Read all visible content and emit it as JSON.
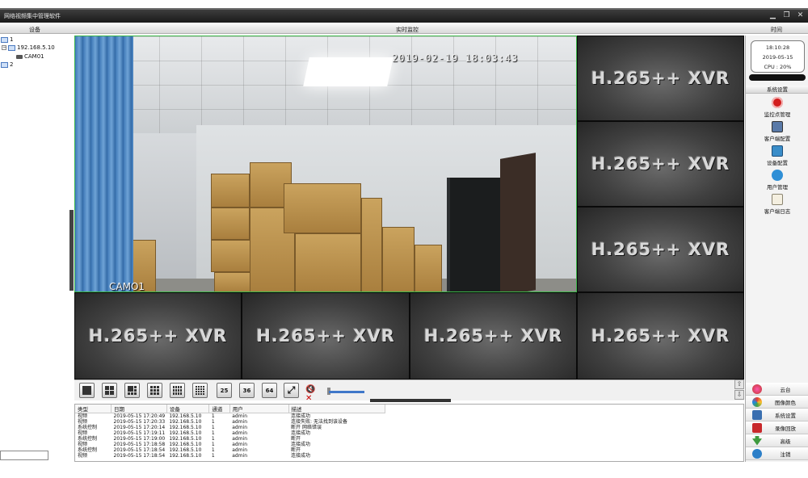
{
  "app": {
    "title": "网络视频集中管理软件"
  },
  "header": {
    "device_label": "设备",
    "live_label": "实时监控",
    "time_label": "时间"
  },
  "tree": {
    "nodes": [
      {
        "label": "1"
      },
      {
        "label": "192.168.5.10"
      },
      {
        "label": "CAM01"
      },
      {
        "label": "2"
      }
    ]
  },
  "main_view": {
    "timestamp": "2019-02-19  18:03:43",
    "camera_name": "CAMO1"
  },
  "placeholder_label": "H.265++ XVR",
  "clock": {
    "time": "18:10:28",
    "date": "2019-05-15",
    "cpu": "CPU : 20%"
  },
  "right_panel": {
    "section_title": "系统设置",
    "buttons": [
      {
        "label": "监控点管理",
        "icon": "record-icon",
        "color": "#d21d1d"
      },
      {
        "label": "客户端配置",
        "icon": "client-config-icon",
        "color": "#5a7aa8"
      },
      {
        "label": "设备配置",
        "icon": "device-config-icon",
        "color": "#3a8dc9"
      },
      {
        "label": "用户管理",
        "icon": "users-icon",
        "color": "#2f8fd6"
      },
      {
        "label": "客户端日志",
        "icon": "log-icon",
        "color": "#e8e0c8"
      }
    ]
  },
  "toolbar": {
    "layouts": [
      "1",
      "4",
      "6",
      "9",
      "12",
      "16",
      "25",
      "36",
      "64"
    ]
  },
  "log": {
    "columns": [
      "类型",
      "日期",
      "设备",
      "通道",
      "用户",
      "描述"
    ],
    "rows": [
      [
        "视频",
        "2019-05-15 17:20:49",
        "192.168.5.10",
        "1",
        "admin",
        "连接成功"
      ],
      [
        "视频",
        "2019-05-15 17:20:33",
        "192.168.5.10",
        "1",
        "admin",
        "连接失败: 无法找到该设备"
      ],
      [
        "系统控制",
        "2019-05-15 17:20:14",
        "192.168.5.10",
        "1",
        "admin",
        "断开 网络错误"
      ],
      [
        "视频",
        "2019-05-15 17:19:11",
        "192.168.5.10",
        "1",
        "admin",
        "连接成功"
      ],
      [
        "系统控制",
        "2019-05-15 17:19:00",
        "192.168.5.10",
        "1",
        "admin",
        "断开"
      ],
      [
        "视频",
        "2019-05-15 17:18:58",
        "192.168.5.10",
        "1",
        "admin",
        "连接成功"
      ],
      [
        "系统控制",
        "2019-05-15 17:18:54",
        "192.168.5.10",
        "1",
        "admin",
        "断开"
      ],
      [
        "视频",
        "2019-05-15 17:18:54",
        "192.168.5.10",
        "1",
        "admin",
        "连接成功"
      ]
    ]
  },
  "right_menu": {
    "items": [
      {
        "label": "云台",
        "icon": "ptz-icon",
        "color": "#c0392b"
      },
      {
        "label": "图像颜色",
        "icon": "color-icon",
        "color": "#2e8b57"
      },
      {
        "label": "系统设置",
        "icon": "settings-icon",
        "color": "#3a6fb0"
      },
      {
        "label": "录像回放",
        "icon": "playback-icon",
        "color": "#c8282b"
      },
      {
        "label": "高级",
        "icon": "advanced-icon",
        "color": "#3e9a3e"
      },
      {
        "label": "注销",
        "icon": "logout-icon",
        "color": "#2c7fc8"
      }
    ]
  }
}
